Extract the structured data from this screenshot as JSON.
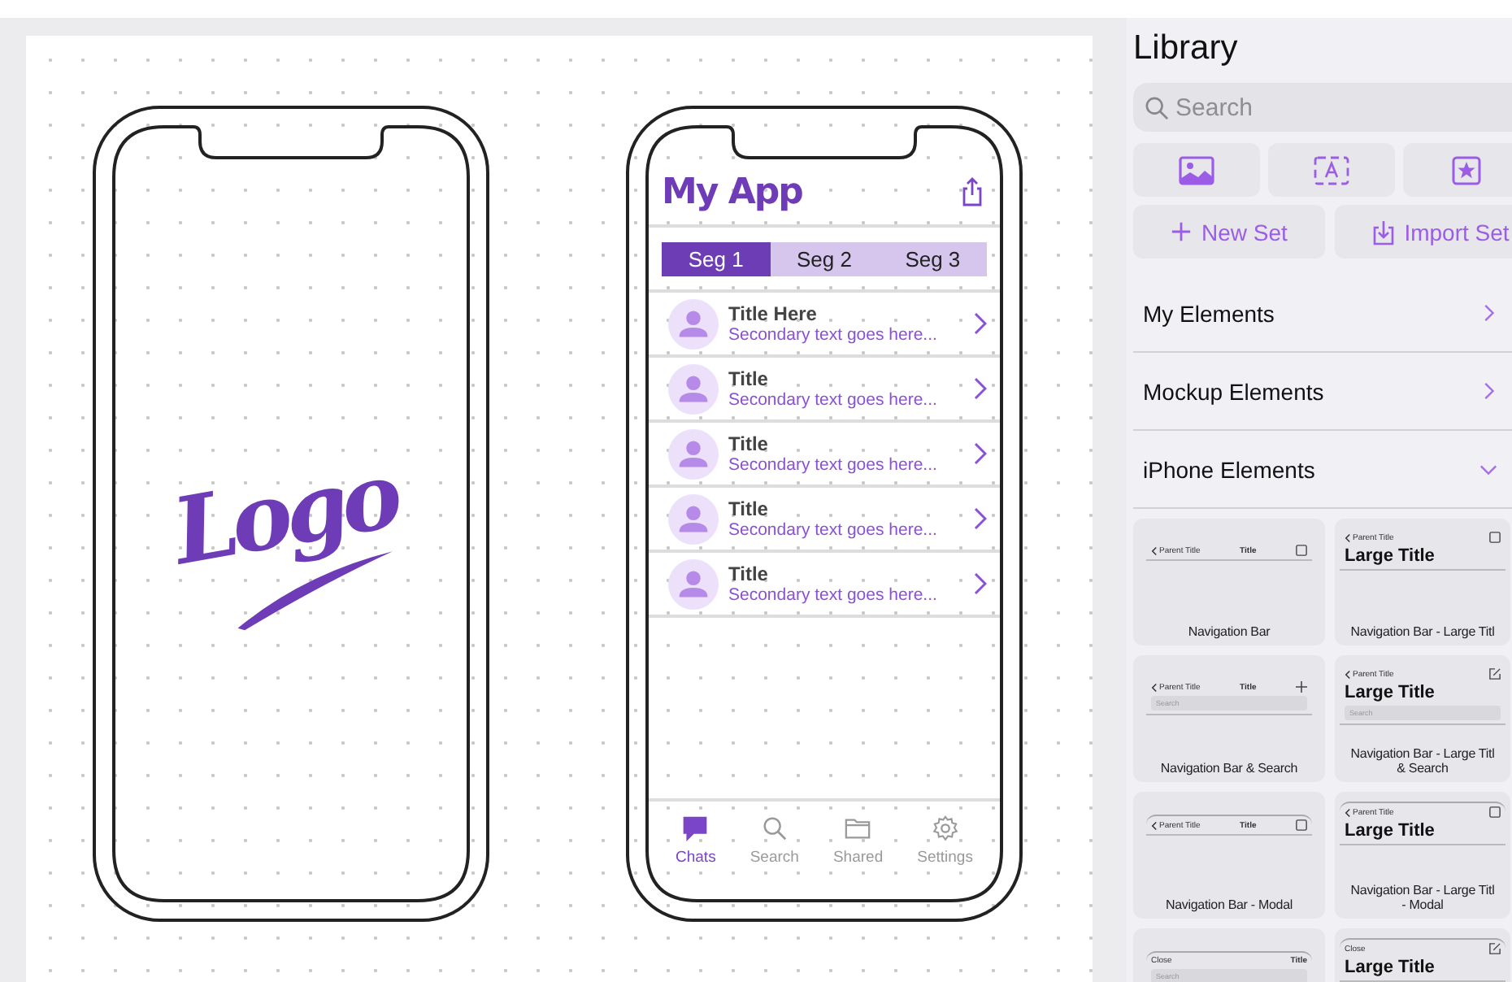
{
  "canvas": {
    "splash_phone": {
      "logo": "Logo"
    },
    "app_phone": {
      "title": "My App",
      "segments": [
        {
          "label": "Seg 1",
          "selected": true
        },
        {
          "label": "Seg 2",
          "selected": false
        },
        {
          "label": "Seg 3",
          "selected": false
        }
      ],
      "rows": [
        {
          "title": "Title Here",
          "subtitle": "Secondary text goes here..."
        },
        {
          "title": "Title",
          "subtitle": "Secondary text goes here..."
        },
        {
          "title": "Title",
          "subtitle": "Secondary text goes here..."
        },
        {
          "title": "Title",
          "subtitle": "Secondary text goes here..."
        },
        {
          "title": "Title",
          "subtitle": "Secondary text goes here..."
        }
      ],
      "tabs": [
        {
          "kind": "chat",
          "label": "Chats",
          "selected": true
        },
        {
          "kind": "search",
          "label": "Search",
          "selected": false
        },
        {
          "kind": "folder",
          "label": "Shared",
          "selected": false
        },
        {
          "kind": "gear",
          "label": "Settings",
          "selected": false
        }
      ]
    }
  },
  "library": {
    "title": "Library",
    "search": {
      "placeholder": "Search"
    },
    "icon_buttons": [
      {
        "kind": "image"
      },
      {
        "kind": "text"
      },
      {
        "kind": "star"
      }
    ],
    "actions": [
      {
        "kind": "add",
        "label": "New Set"
      },
      {
        "kind": "import",
        "label": "Import Set"
      }
    ],
    "sections": [
      {
        "label": "My Elements",
        "expanded": false
      },
      {
        "label": "Mockup Elements",
        "expanded": false
      },
      {
        "label": "iPhone Elements",
        "expanded": true
      }
    ],
    "cards": [
      {
        "caption": "Navigation Bar",
        "preview": {
          "kind": "nav",
          "back": true,
          "leading": "Parent Title",
          "title": "Title",
          "action": {
            "kind": "square"
          },
          "modal": false
        }
      },
      {
        "caption": "Navigation Bar - Large Titl",
        "preview": {
          "kind": "large",
          "back": true,
          "leading": "Parent Title",
          "title": "Large Title",
          "action": {
            "kind": "square"
          },
          "modal": false
        }
      },
      {
        "caption": "Navigation Bar & Search",
        "preview": {
          "kind": "nav",
          "back": true,
          "leading": "Parent Title",
          "title": "Title",
          "action": {
            "kind": "plus"
          },
          "search": "Search",
          "modal": false
        }
      },
      {
        "caption": "Navigation Bar - Large Titl\n& Search",
        "preview": {
          "kind": "large",
          "back": true,
          "leading": "Parent Title",
          "title": "Large Title",
          "action": {
            "kind": "edit"
          },
          "search": "Search",
          "modal": false
        }
      },
      {
        "caption": "Navigation Bar - Modal",
        "preview": {
          "kind": "nav",
          "back": true,
          "leading": "Parent Title",
          "title": "Title",
          "action": {
            "kind": "square"
          },
          "modal": true
        }
      },
      {
        "caption": "Navigation Bar - Large Titl\n- Modal",
        "preview": {
          "kind": "large",
          "back": true,
          "leading": "Parent Title",
          "title": "Large Title",
          "action": {
            "kind": "square"
          },
          "modal": true
        }
      },
      {
        "preview": {
          "kind": "nav",
          "back": false,
          "leading": "Close",
          "title": "Title",
          "search": "Search",
          "modal": true
        }
      },
      {
        "preview": {
          "kind": "large",
          "back": false,
          "leading": "Close",
          "title": "Large Title",
          "action": {
            "kind": "edit"
          },
          "modal": true
        }
      }
    ]
  }
}
